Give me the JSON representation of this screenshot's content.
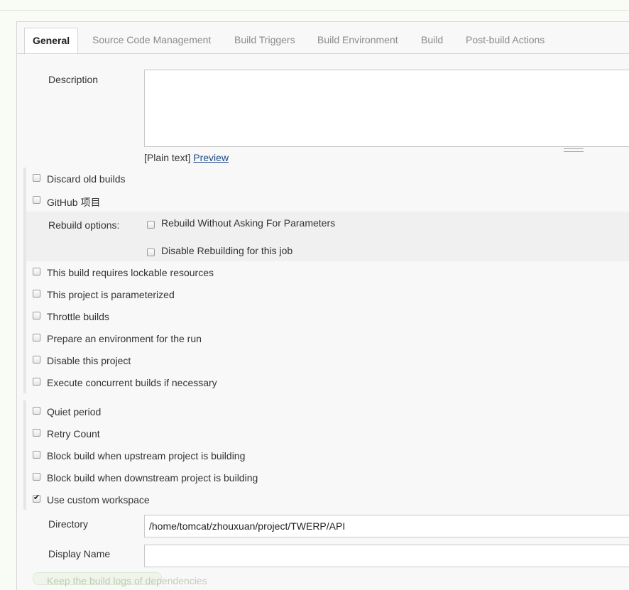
{
  "tabs": [
    {
      "label": "General"
    },
    {
      "label": "Source Code Management"
    },
    {
      "label": "Build Triggers"
    },
    {
      "label": "Build Environment"
    },
    {
      "label": "Build"
    },
    {
      "label": "Post-build Actions"
    }
  ],
  "description": {
    "label": "Description",
    "value": "",
    "plain_text": "[Plain text]",
    "preview_link": "Preview"
  },
  "options_group1": [
    {
      "label": "Discard old builds",
      "checked": false
    },
    {
      "label": "GitHub 项目",
      "checked": false
    }
  ],
  "rebuild": {
    "label": "Rebuild options:",
    "options": [
      {
        "label": "Rebuild Without Asking For Parameters",
        "checked": false
      },
      {
        "label": "Disable Rebuilding for this job",
        "checked": false
      }
    ]
  },
  "options_group2": [
    {
      "label": "This build requires lockable resources",
      "checked": false
    },
    {
      "label": "This project is parameterized",
      "checked": false
    },
    {
      "label": "Throttle builds",
      "checked": false
    },
    {
      "label": "Prepare an environment for the run",
      "checked": false
    },
    {
      "label": "Disable this project",
      "checked": false
    },
    {
      "label": "Execute concurrent builds if necessary",
      "checked": false
    }
  ],
  "options_group3": [
    {
      "label": "Quiet period",
      "checked": false
    },
    {
      "label": "Retry Count",
      "checked": false
    },
    {
      "label": "Block build when upstream project is building",
      "checked": false
    },
    {
      "label": "Block build when downstream project is building",
      "checked": false
    },
    {
      "label": "Use custom workspace",
      "checked": true
    }
  ],
  "workspace": {
    "directory_label": "Directory",
    "directory_value": "/home/tomcat/zhouxuan/project/TWERP/API",
    "display_name_label": "Display Name",
    "display_name_value": ""
  },
  "partial_row": {
    "label": "Keep the build logs of dependencies"
  }
}
